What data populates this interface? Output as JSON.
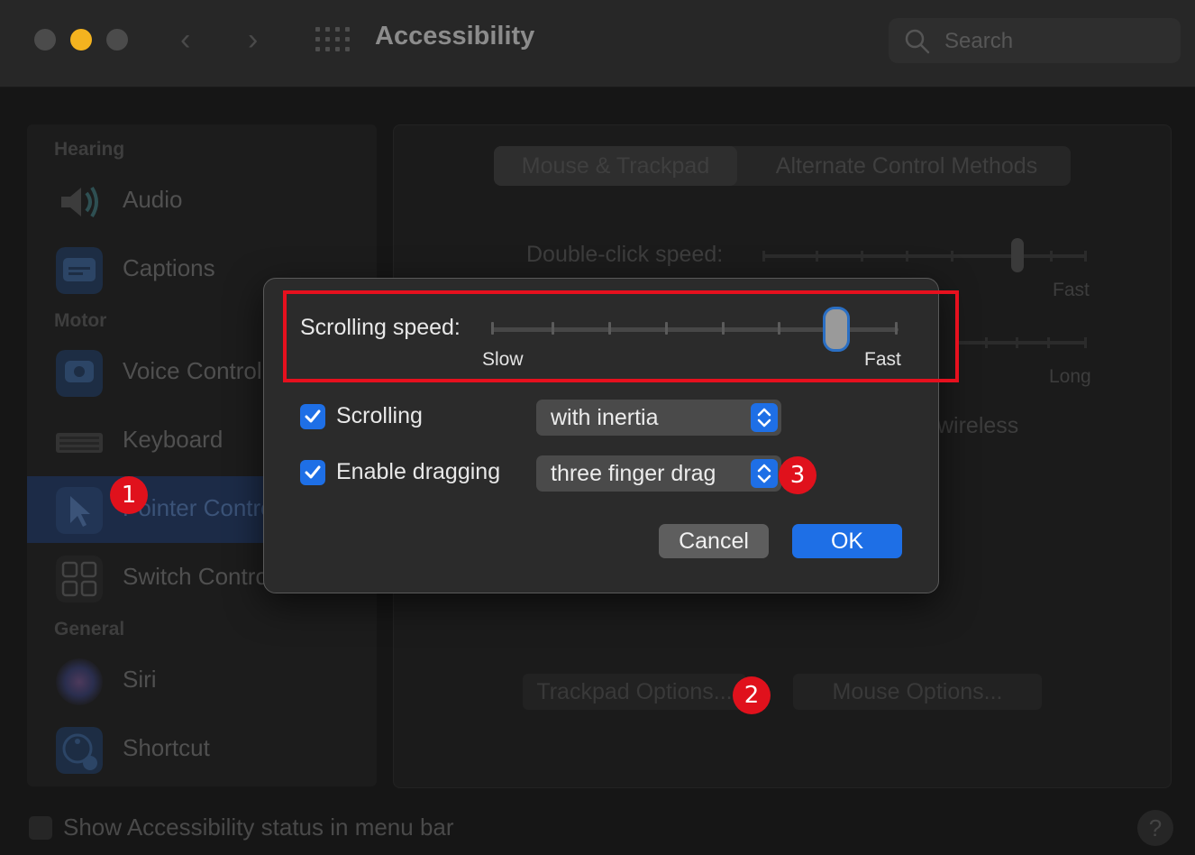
{
  "window": {
    "title": "Accessibility",
    "search_placeholder": "Search"
  },
  "sidebar": {
    "sections": {
      "hearing": "Hearing",
      "motor": "Motor",
      "general": "General"
    },
    "items": [
      {
        "label": "Audio",
        "icon": "speaker-icon"
      },
      {
        "label": "Captions",
        "icon": "captions-icon"
      },
      {
        "label": "Voice Control",
        "icon": "voice-control-icon"
      },
      {
        "label": "Keyboard",
        "icon": "keyboard-icon"
      },
      {
        "label": "Pointer Control",
        "icon": "pointer-icon",
        "selected": true
      },
      {
        "label": "Switch Control",
        "icon": "switch-control-icon"
      },
      {
        "label": "Siri",
        "icon": "siri-icon"
      },
      {
        "label": "Shortcut",
        "icon": "accessibility-shortcut-icon"
      }
    ]
  },
  "main": {
    "tabs": [
      "Mouse & Trackpad",
      "Alternate Control Methods"
    ],
    "double_click_label": "Double-click speed:",
    "fast_label": "Fast",
    "long_label": "Long",
    "wireless_text": "wireless",
    "trackpad_options": "Trackpad Options...",
    "mouse_options": "Mouse Options..."
  },
  "footer": {
    "status_text": "Show Accessibility status in menu bar",
    "help": "?"
  },
  "dialog": {
    "scrolling_speed_label": "Scrolling speed:",
    "slow_label": "Slow",
    "fast_label": "Fast",
    "scrolling_speed_value_fraction": 0.83,
    "scrolling_checkbox_label": "Scrolling",
    "scrolling_checked": true,
    "scrolling_mode": "with inertia",
    "dragging_checkbox_label": "Enable dragging",
    "dragging_checked": true,
    "dragging_mode": "three finger drag",
    "cancel": "Cancel",
    "ok": "OK"
  },
  "annotations": {
    "markers": [
      "1",
      "2",
      "3"
    ],
    "highlight_color": "#e6101e"
  },
  "colors": {
    "accent": "#1e6fe6",
    "traffic_minimize": "#f4b31f"
  }
}
